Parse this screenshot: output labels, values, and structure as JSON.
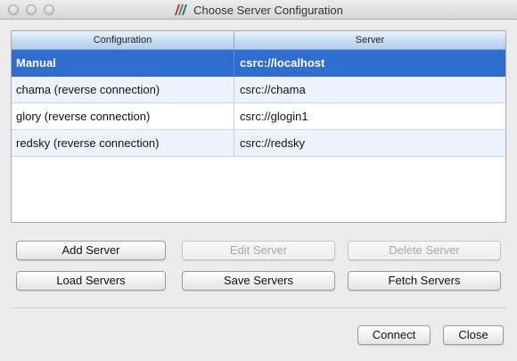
{
  "window": {
    "title": "Choose Server Configuration",
    "app_icon": "paraview-logo-icon",
    "controls": [
      "close-icon",
      "minimize-icon",
      "zoom-icon"
    ]
  },
  "table": {
    "columns": [
      "Configuration",
      "Server"
    ],
    "rows": [
      {
        "configuration": "Manual",
        "server": "csrc://localhost",
        "selected": true
      },
      {
        "configuration": "chama (reverse connection)",
        "server": "csrc://chama",
        "selected": false
      },
      {
        "configuration": "glory (reverse connection)",
        "server": "csrc://glogin1",
        "selected": false
      },
      {
        "configuration": "redsky (reverse connection)",
        "server": "csrc://redsky",
        "selected": false
      }
    ]
  },
  "buttons": {
    "add_server": "Add Server",
    "edit_server": "Edit Server",
    "delete_server": "Delete Server",
    "load_servers": "Load Servers",
    "save_servers": "Save Servers",
    "fetch_servers": "Fetch Servers",
    "connect": "Connect",
    "close": "Close"
  },
  "colors": {
    "selection": "#2f6dd1",
    "row_alt": "#edf3fe",
    "header_gradient": "#c6dcf3"
  }
}
